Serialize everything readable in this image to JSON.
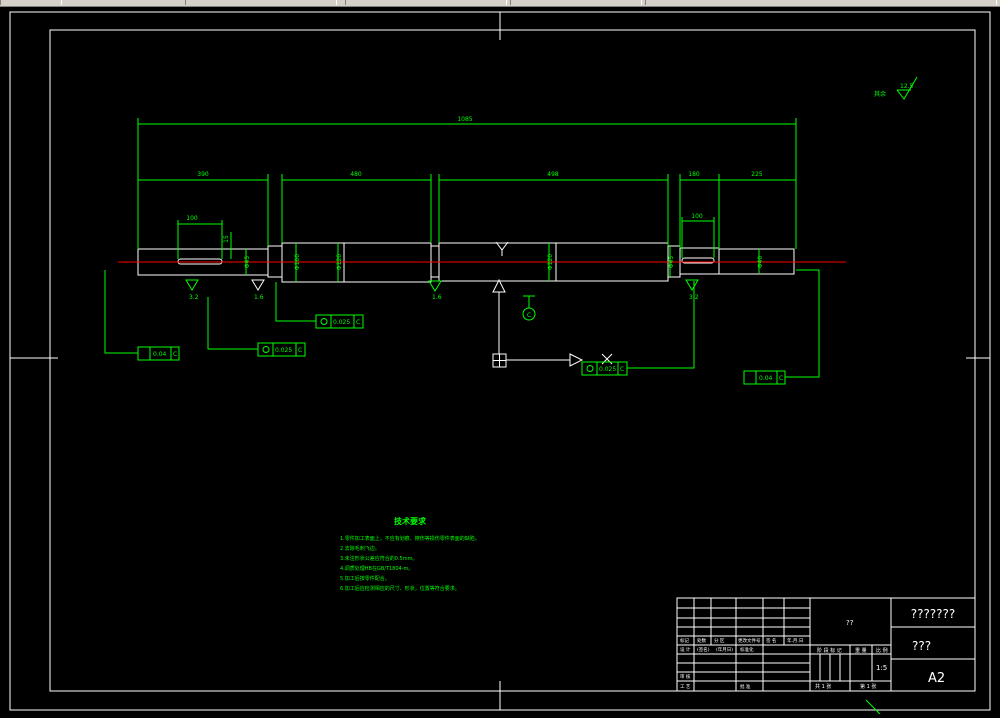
{
  "colors": {
    "background": "#000000",
    "dimension": "#00ff00",
    "outline": "#ffffff",
    "centerline": "#ff0000"
  },
  "dimensions": {
    "overall": "1085",
    "seg1": "390",
    "seg2": "480",
    "seg3": "498",
    "seg4": "180",
    "seg5": "225",
    "key1": "100",
    "key2": "100",
    "height1": "15",
    "dia_a": "Φ45",
    "dia_b": "Φ100",
    "dia_c": "Φ120",
    "dia_d": "Φ120",
    "dia_e": "Φ45",
    "dia_f": "Φ40"
  },
  "roughness": {
    "r1": "3.2",
    "r2": "1.6",
    "r3": "1.6",
    "r4": "3.2",
    "other_label": "其余",
    "other_value": "12.5"
  },
  "tolerances": {
    "t1": {
      "value": "0.04",
      "datum": "C"
    },
    "t2": {
      "value": "0.025",
      "datum": "C"
    },
    "t3": {
      "value": "0.025",
      "datum": "C"
    },
    "t4": {
      "value": "0.025",
      "datum": "C"
    },
    "t5": {
      "value": "0.04",
      "datum": "C"
    }
  },
  "datum_label": "C",
  "tech_requirements": {
    "title": "技术要求",
    "items": [
      "1.零件加工表面上，不应有划痕、擦伤等损伤零件表面的缺陷。",
      "2.去除毛刺飞边。",
      "3.未注形状公差应符合的0.5mm。",
      "4.调质处理HB在GB/T1804-m。",
      "5.加工后按零件配合。",
      "6.加工后应检测相应的尺寸、形状，位置等符合要求。"
    ]
  },
  "title_block": {
    "part_name": "???????",
    "drawing_no": "???",
    "sheet_size": "A2",
    "material": "??",
    "scale": "1:5",
    "row_labels": [
      "标记",
      "处数",
      "分 区",
      "更改文件号",
      "签 名",
      "年.月.日"
    ],
    "design_row": [
      "设 计",
      "(签名)",
      "(年月日)",
      "标准化"
    ],
    "review_row": [
      "审 核"
    ],
    "process_row": [
      "工 艺",
      "批 准"
    ],
    "stage_labels": [
      "阶 段 标 记",
      "重 量",
      "比 例"
    ],
    "sheet_total": "共 1 张",
    "sheet_no": "第 1 张"
  }
}
